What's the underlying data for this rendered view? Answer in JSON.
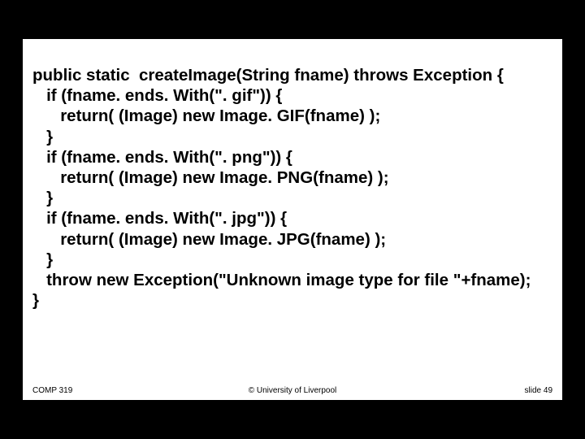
{
  "code": {
    "l1": "public static  createImage(String fname) throws Exception {",
    "l2": "   if (fname. ends. With(\". gif\")) {",
    "l3": "      return( (Image) new Image. GIF(fname) );",
    "l4": "   }",
    "l5": "   if (fname. ends. With(\". png\")) {",
    "l6": "      return( (Image) new Image. PNG(fname) );",
    "l7": "   }",
    "l8": "   if (fname. ends. With(\". jpg\")) {",
    "l9": "      return( (Image) new Image. JPG(fname) );",
    "l10": "   }",
    "l11": "   throw new Exception(\"Unknown image type for file \"+fname);",
    "l12": "}"
  },
  "footer": {
    "left": "COMP 319",
    "center": "© University of Liverpool",
    "right": "slide  49"
  }
}
